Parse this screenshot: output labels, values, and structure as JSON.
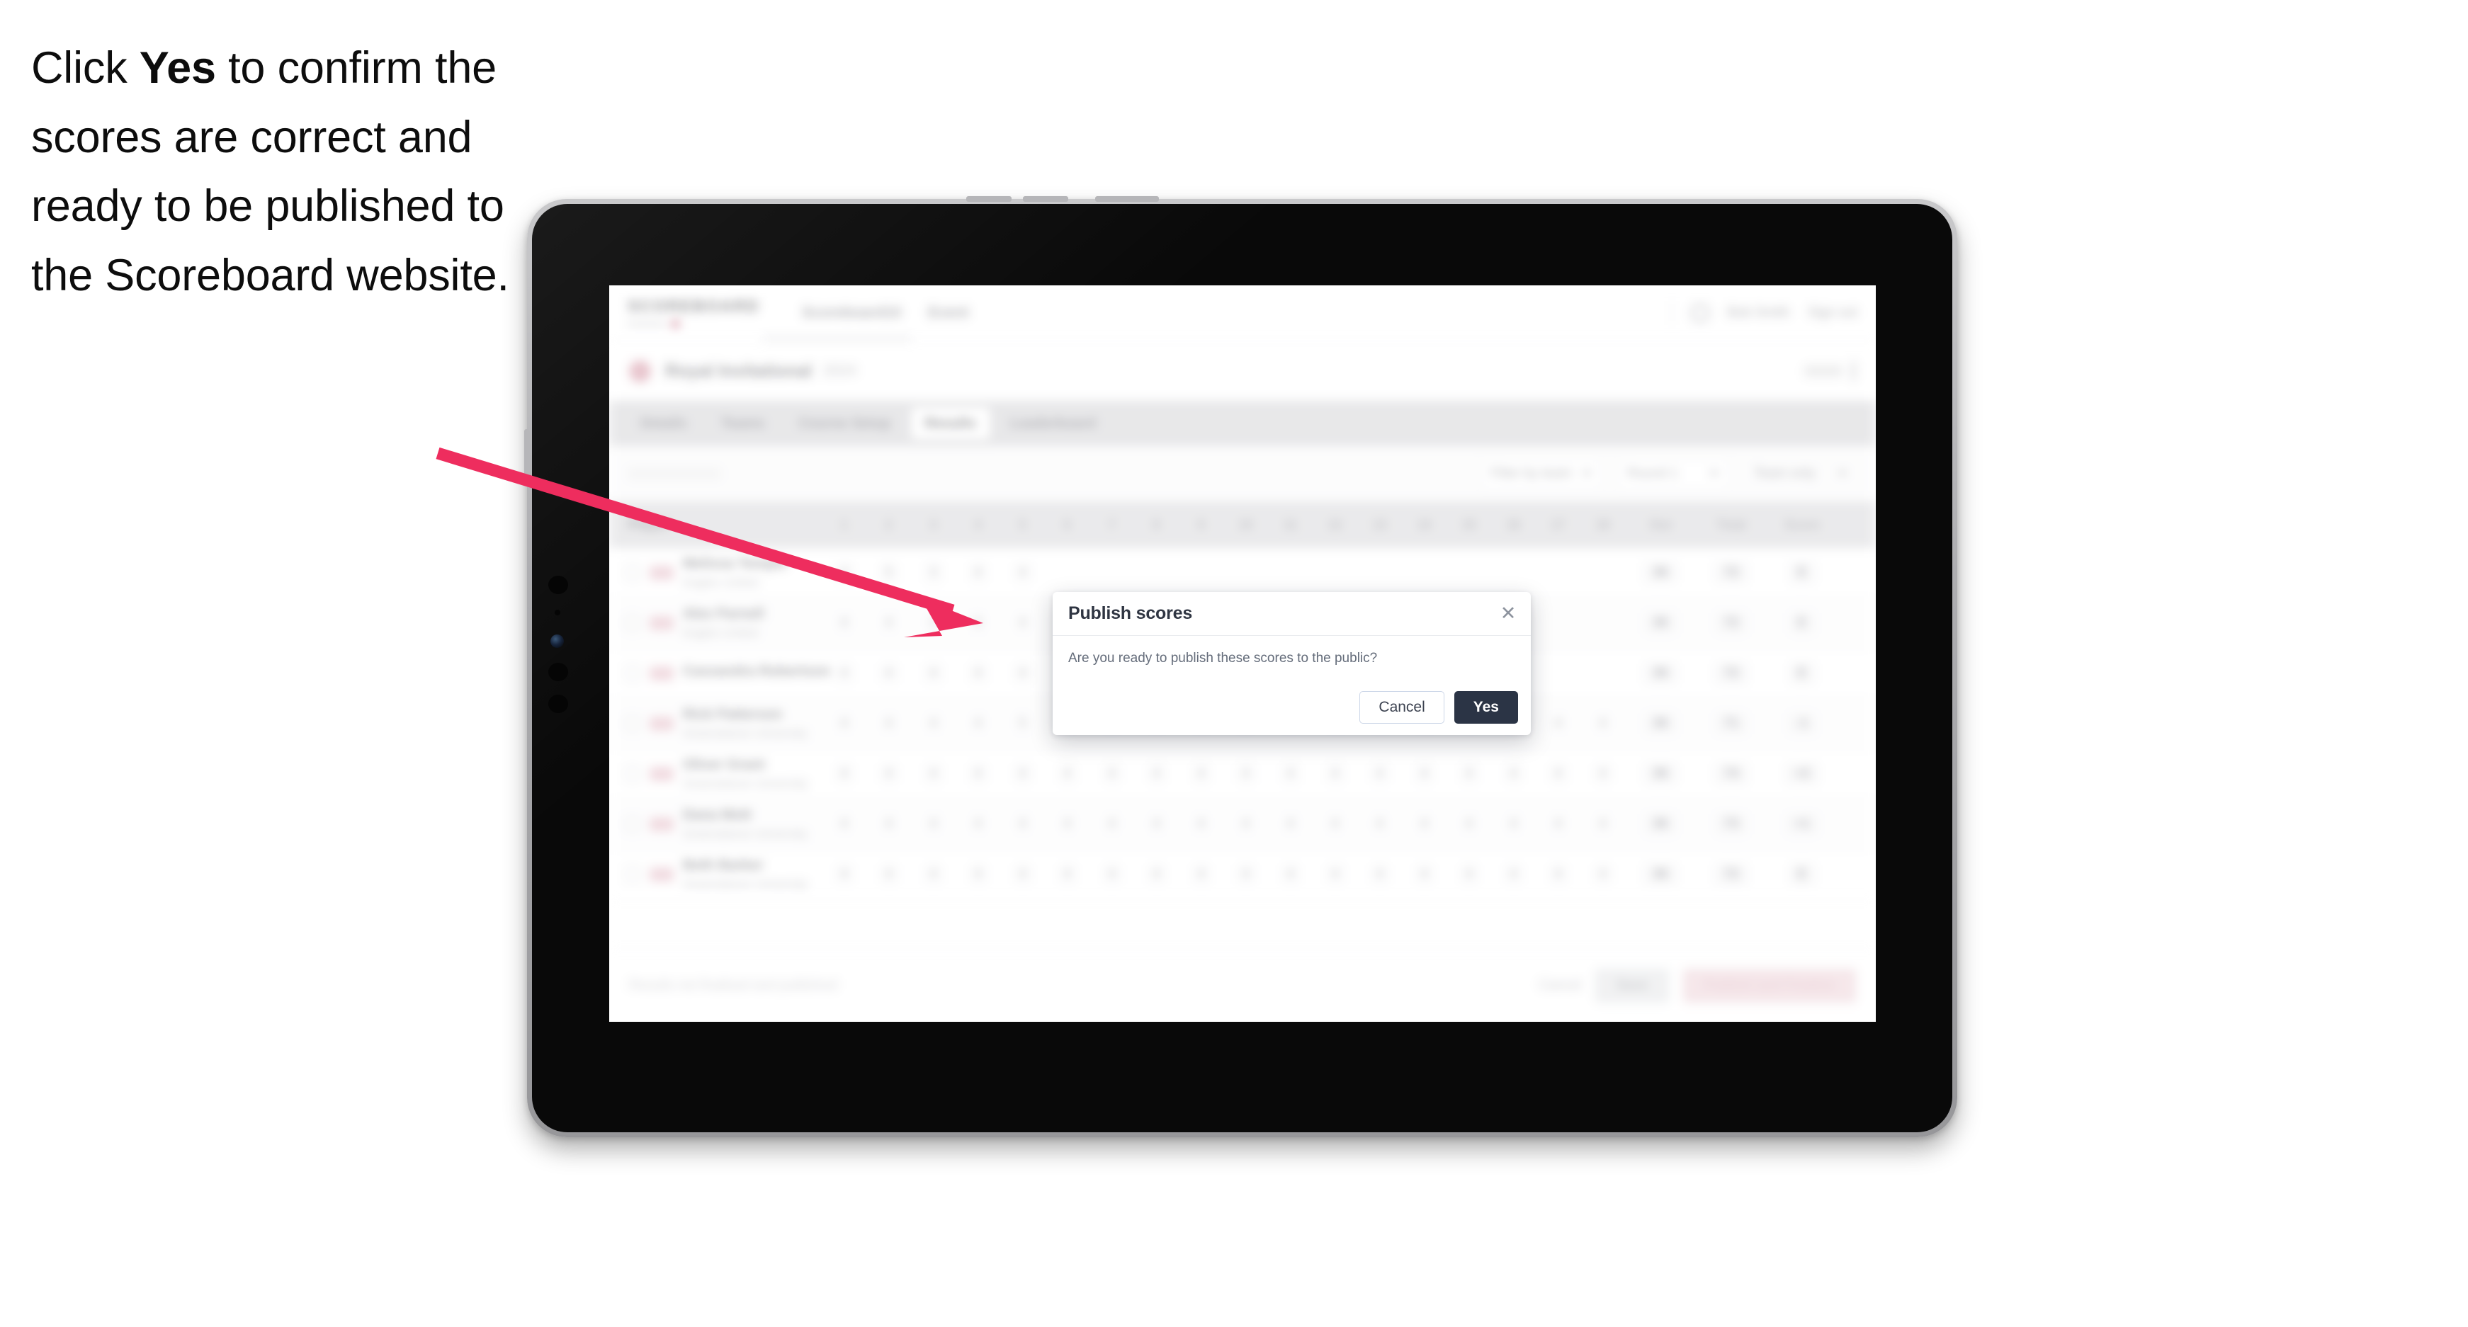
{
  "caption": {
    "part1": "Click ",
    "emphasis": "Yes",
    "part2": " to confirm the scores are correct and ready to be published to the Scoreboard website."
  },
  "annotation": {
    "arrow_color": "#ee2d5e",
    "arrow_name": "pointer-arrow"
  },
  "device": {
    "type": "tablet",
    "frame_color": "#aeaeb1",
    "bezel_color": "#090909"
  },
  "app": {
    "nav": {
      "brand": "SCOREBOARD",
      "links": [
        "Scoreboard10",
        "Event"
      ],
      "user": "Bob Smith",
      "signout": "Sign out",
      "bell_icon": "bell-icon"
    },
    "event": {
      "icon": "event-avatar-icon",
      "title": "Royal Invitational",
      "subtitle": "2024",
      "round_label": "Final",
      "menu_icon": "kebab-menu-icon"
    },
    "tabs": [
      {
        "label": "Details",
        "active": false
      },
      {
        "label": "Teams",
        "active": false
      },
      {
        "label": "Course Setup",
        "active": false
      },
      {
        "label": "Results",
        "active": true
      },
      {
        "label": "Leaderboard",
        "active": false
      }
    ],
    "toolbar": {
      "left_label": "Round 1 scores",
      "controls": [
        {
          "label": "Filter by team",
          "icon": "chevron-down-icon"
        },
        {
          "label": "Round 1",
          "icon": "chevron-down-icon"
        },
        {
          "label": "Team only",
          "icon": "chevron-down-icon"
        }
      ]
    },
    "table": {
      "player_header": "Player",
      "hole_headers": [
        "1",
        "2",
        "3",
        "4",
        "5",
        "6",
        "7",
        "8",
        "9",
        "10",
        "11",
        "12",
        "13",
        "14",
        "15",
        "16",
        "17",
        "18"
      ],
      "wide_headers": [
        "Out",
        "Total",
        "Score"
      ],
      "rows": [
        {
          "badge": "badge",
          "name": "Melissa Temple",
          "team": "Eagles United",
          "holes": [
            "4",
            "5",
            "3",
            "4",
            "4",
            "",
            "",
            "",
            "",
            "",
            "",
            "",
            "",
            "",
            "",
            "",
            "",
            ""
          ],
          "out": "36",
          "total": "72",
          "score": "E",
          "score2": "+2"
        },
        {
          "badge": "badge",
          "name": "Alex Parnell",
          "team": "Eagles United",
          "holes": [
            "4",
            "4",
            "3",
            "5",
            "4",
            "",
            "",
            "",
            "",
            "",
            "",
            "",
            "",
            "",
            "",
            "",
            "",
            ""
          ],
          "out": "36",
          "total": "72",
          "score": "E",
          "score2": "+1"
        },
        {
          "badge": "badge",
          "name": "Cassandra Robertson",
          "team": "",
          "holes": [
            "4",
            "4",
            "4",
            "4",
            "4",
            "",
            "",
            "",
            "",
            "",
            "",
            "",
            "",
            "",
            "",
            "",
            "",
            ""
          ],
          "out": "36",
          "total": "72",
          "score": "E",
          "score2": "+3"
        },
        {
          "badge": "badge",
          "name": "Rick Patterson",
          "team": "Greensleeve University",
          "holes": [
            "4",
            "4",
            "4",
            "4",
            "5",
            "4",
            "3",
            "4",
            "4",
            "5",
            "4",
            "4",
            "4",
            "4",
            "4",
            "4",
            "4",
            "4"
          ],
          "out": "36",
          "total": "71",
          "score": "-1",
          "score2": "+1"
        },
        {
          "badge": "badge",
          "name": "Oliver Grant",
          "team": "Greensleeve University",
          "holes": [
            "4",
            "4",
            "4",
            "4",
            "4",
            "4",
            "4",
            "4",
            "4",
            "4",
            "4",
            "4",
            "4",
            "4",
            "4",
            "4",
            "4",
            "4"
          ],
          "out": "36",
          "total": "74",
          "score": "+2",
          "score2": "+4"
        },
        {
          "badge": "badge",
          "name": "Dana Mott",
          "team": "Greensleeve University",
          "holes": [
            "4",
            "4",
            "4",
            "4",
            "4",
            "4",
            "4",
            "4",
            "4",
            "4",
            "4",
            "4",
            "4",
            "4",
            "4",
            "4",
            "4",
            "4"
          ],
          "out": "36",
          "total": "73",
          "score": "+1",
          "score2": "+2"
        },
        {
          "badge": "badge",
          "name": "Beth Barker",
          "team": "Greensleeve University",
          "holes": [
            "4",
            "4",
            "4",
            "4",
            "4",
            "4",
            "4",
            "4",
            "4",
            "4",
            "4",
            "4",
            "4",
            "4",
            "4",
            "4",
            "4",
            "4"
          ],
          "out": "36",
          "total": "72",
          "score": "E",
          "score2": "+2"
        }
      ]
    },
    "footer": {
      "note": "Results not finalised and published",
      "link": "Cancel",
      "button_secondary": "Save",
      "button_primary": "Publish and Finalise"
    }
  },
  "dialog": {
    "title": "Publish scores",
    "body": "Are you ready to publish these scores to the public?",
    "cancel_label": "Cancel",
    "confirm_label": "Yes",
    "close_icon": "close-icon",
    "close_glyph": "✕",
    "primary_color": "#2b3445"
  }
}
